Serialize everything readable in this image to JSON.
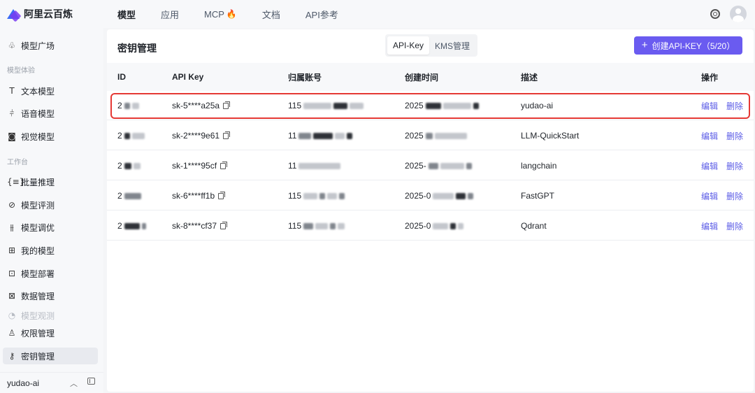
{
  "app": {
    "logo_text": "阿里云百炼"
  },
  "topnav": {
    "items": [
      "模型",
      "应用",
      "MCP",
      "文档",
      "API参考"
    ],
    "active": "模型",
    "mcp_flame": "🔥"
  },
  "sidebar": {
    "top_item": "模型广场",
    "group1": "模型体验",
    "g1_items": [
      "文本模型",
      "语音模型",
      "视觉模型"
    ],
    "group2": "工作台",
    "g2_items": [
      "批量推理",
      "模型评测",
      "模型调优",
      "我的模型",
      "模型部署",
      "数据管理",
      "模型观测",
      "权限管理",
      "密钥管理"
    ],
    "active": "密钥管理",
    "bottom_user": "yudao-ai"
  },
  "main": {
    "title": "密钥管理",
    "seg": [
      "API-Key",
      "KMS管理"
    ],
    "seg_active": "API-Key",
    "create_label": "创建API-KEY（5/20）"
  },
  "table": {
    "headers": [
      "ID",
      "API Key",
      "归属账号",
      "创建时间",
      "描述",
      "操作"
    ],
    "rows": [
      {
        "id": "2",
        "key": "sk-5****a25a",
        "account": "115",
        "created": "2025",
        "desc": "yudao-ai"
      },
      {
        "id": "2",
        "key": "sk-2****9e61",
        "account": "11",
        "created": "2025",
        "desc": "LLM-QuickStart"
      },
      {
        "id": "2",
        "key": "sk-1****95cf",
        "account": "11",
        "created": "2025-",
        "desc": "langchain"
      },
      {
        "id": "2",
        "key": "sk-6****ff1b",
        "account": "115",
        "created": "2025-0",
        "desc": "FastGPT"
      },
      {
        "id": "2",
        "key": "sk-8****cf37",
        "account": "115",
        "created": "2025-0",
        "desc": "Qdrant"
      }
    ],
    "edit_label": "编辑",
    "delete_label": "删除"
  },
  "colors": {
    "accent": "#6a5bf0",
    "link": "#5b5ce6",
    "highlight": "#e53935"
  }
}
